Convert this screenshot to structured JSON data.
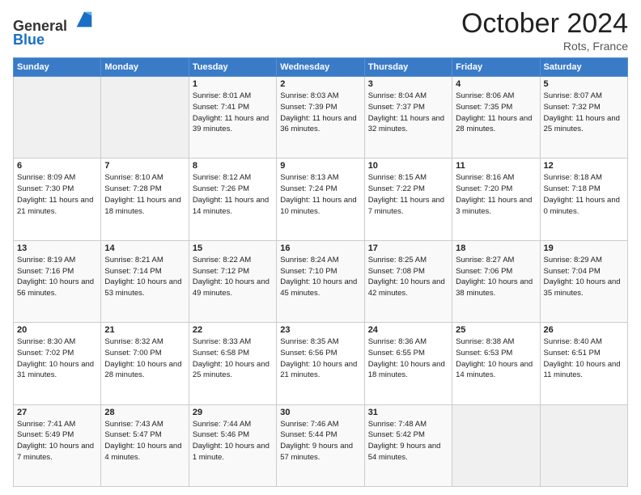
{
  "header": {
    "logo_line1": "General",
    "logo_line2": "Blue",
    "month_title": "October 2024",
    "location": "Rots, France"
  },
  "weekdays": [
    "Sunday",
    "Monday",
    "Tuesday",
    "Wednesday",
    "Thursday",
    "Friday",
    "Saturday"
  ],
  "weeks": [
    [
      {
        "day": "",
        "info": ""
      },
      {
        "day": "",
        "info": ""
      },
      {
        "day": "1",
        "info": "Sunrise: 8:01 AM\nSunset: 7:41 PM\nDaylight: 11 hours and 39 minutes."
      },
      {
        "day": "2",
        "info": "Sunrise: 8:03 AM\nSunset: 7:39 PM\nDaylight: 11 hours and 36 minutes."
      },
      {
        "day": "3",
        "info": "Sunrise: 8:04 AM\nSunset: 7:37 PM\nDaylight: 11 hours and 32 minutes."
      },
      {
        "day": "4",
        "info": "Sunrise: 8:06 AM\nSunset: 7:35 PM\nDaylight: 11 hours and 28 minutes."
      },
      {
        "day": "5",
        "info": "Sunrise: 8:07 AM\nSunset: 7:32 PM\nDaylight: 11 hours and 25 minutes."
      }
    ],
    [
      {
        "day": "6",
        "info": "Sunrise: 8:09 AM\nSunset: 7:30 PM\nDaylight: 11 hours and 21 minutes."
      },
      {
        "day": "7",
        "info": "Sunrise: 8:10 AM\nSunset: 7:28 PM\nDaylight: 11 hours and 18 minutes."
      },
      {
        "day": "8",
        "info": "Sunrise: 8:12 AM\nSunset: 7:26 PM\nDaylight: 11 hours and 14 minutes."
      },
      {
        "day": "9",
        "info": "Sunrise: 8:13 AM\nSunset: 7:24 PM\nDaylight: 11 hours and 10 minutes."
      },
      {
        "day": "10",
        "info": "Sunrise: 8:15 AM\nSunset: 7:22 PM\nDaylight: 11 hours and 7 minutes."
      },
      {
        "day": "11",
        "info": "Sunrise: 8:16 AM\nSunset: 7:20 PM\nDaylight: 11 hours and 3 minutes."
      },
      {
        "day": "12",
        "info": "Sunrise: 8:18 AM\nSunset: 7:18 PM\nDaylight: 11 hours and 0 minutes."
      }
    ],
    [
      {
        "day": "13",
        "info": "Sunrise: 8:19 AM\nSunset: 7:16 PM\nDaylight: 10 hours and 56 minutes."
      },
      {
        "day": "14",
        "info": "Sunrise: 8:21 AM\nSunset: 7:14 PM\nDaylight: 10 hours and 53 minutes."
      },
      {
        "day": "15",
        "info": "Sunrise: 8:22 AM\nSunset: 7:12 PM\nDaylight: 10 hours and 49 minutes."
      },
      {
        "day": "16",
        "info": "Sunrise: 8:24 AM\nSunset: 7:10 PM\nDaylight: 10 hours and 45 minutes."
      },
      {
        "day": "17",
        "info": "Sunrise: 8:25 AM\nSunset: 7:08 PM\nDaylight: 10 hours and 42 minutes."
      },
      {
        "day": "18",
        "info": "Sunrise: 8:27 AM\nSunset: 7:06 PM\nDaylight: 10 hours and 38 minutes."
      },
      {
        "day": "19",
        "info": "Sunrise: 8:29 AM\nSunset: 7:04 PM\nDaylight: 10 hours and 35 minutes."
      }
    ],
    [
      {
        "day": "20",
        "info": "Sunrise: 8:30 AM\nSunset: 7:02 PM\nDaylight: 10 hours and 31 minutes."
      },
      {
        "day": "21",
        "info": "Sunrise: 8:32 AM\nSunset: 7:00 PM\nDaylight: 10 hours and 28 minutes."
      },
      {
        "day": "22",
        "info": "Sunrise: 8:33 AM\nSunset: 6:58 PM\nDaylight: 10 hours and 25 minutes."
      },
      {
        "day": "23",
        "info": "Sunrise: 8:35 AM\nSunset: 6:56 PM\nDaylight: 10 hours and 21 minutes."
      },
      {
        "day": "24",
        "info": "Sunrise: 8:36 AM\nSunset: 6:55 PM\nDaylight: 10 hours and 18 minutes."
      },
      {
        "day": "25",
        "info": "Sunrise: 8:38 AM\nSunset: 6:53 PM\nDaylight: 10 hours and 14 minutes."
      },
      {
        "day": "26",
        "info": "Sunrise: 8:40 AM\nSunset: 6:51 PM\nDaylight: 10 hours and 11 minutes."
      }
    ],
    [
      {
        "day": "27",
        "info": "Sunrise: 7:41 AM\nSunset: 5:49 PM\nDaylight: 10 hours and 7 minutes."
      },
      {
        "day": "28",
        "info": "Sunrise: 7:43 AM\nSunset: 5:47 PM\nDaylight: 10 hours and 4 minutes."
      },
      {
        "day": "29",
        "info": "Sunrise: 7:44 AM\nSunset: 5:46 PM\nDaylight: 10 hours and 1 minute."
      },
      {
        "day": "30",
        "info": "Sunrise: 7:46 AM\nSunset: 5:44 PM\nDaylight: 9 hours and 57 minutes."
      },
      {
        "day": "31",
        "info": "Sunrise: 7:48 AM\nSunset: 5:42 PM\nDaylight: 9 hours and 54 minutes."
      },
      {
        "day": "",
        "info": ""
      },
      {
        "day": "",
        "info": ""
      }
    ]
  ]
}
